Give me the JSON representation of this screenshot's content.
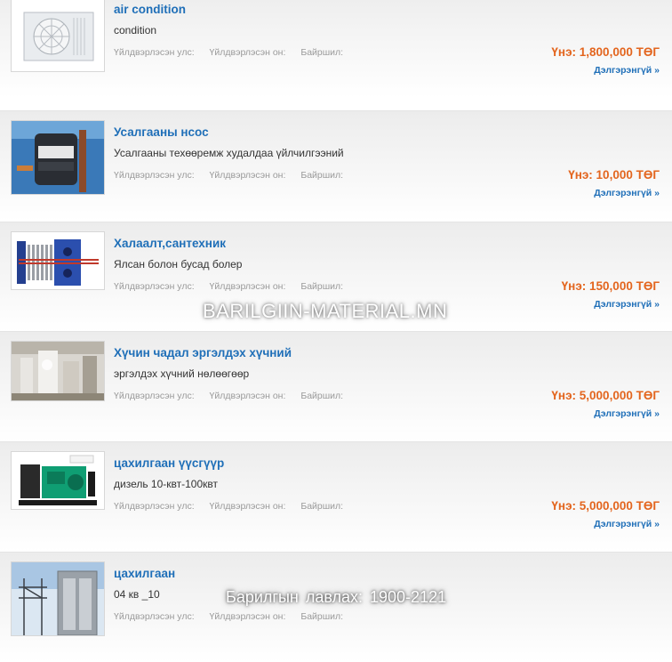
{
  "listings": [
    {
      "title": "air condition",
      "description": "condition",
      "meta_country": "Үйлдвэрлэсэн улс:",
      "meta_year": "Үйлдвэрлэсэн он:",
      "meta_location": "Байршил:",
      "price": "Үнэ: 1,800,000 ТӨГ",
      "more": "Дэлгэрэнгүй »",
      "image_icon": "air-conditioner-image"
    },
    {
      "title": "Усалгааны нсос",
      "description": "Усалгааны техөөремж худалдаа үйлчилгээний",
      "meta_country": "Үйлдвэрлэсэн улс:",
      "meta_year": "Үйлдвэрлэсэн он:",
      "meta_location": "Байршил:",
      "price": "Үнэ: 10,000 ТӨГ",
      "more": "Дэлгэрэнгүй »",
      "image_icon": "pump-image"
    },
    {
      "title": "Халаалт,сантехник",
      "description": "Ялсан болон бусад болер",
      "meta_country": "Үйлдвэрлэсэн улс:",
      "meta_year": "Үйлдвэрлэсэн он:",
      "meta_location": "Байршил:",
      "price": "Үнэ: 150,000 ТӨГ",
      "more": "Дэлгэрэнгүй »",
      "image_icon": "heat-exchanger-image"
    },
    {
      "title": "Хүчин чадал эргэлдэх хүчний",
      "description": "эргэлдэх хүчний нөлөөгөөр",
      "meta_country": "Үйлдвэрлэсэн улс:",
      "meta_year": "Үйлдвэрлэсэн он:",
      "meta_location": "Байршил:",
      "price": "Үнэ: 5,000,000 ТӨГ",
      "more": "Дэлгэрэнгүй »",
      "image_icon": "factory-image"
    },
    {
      "title": "цахилгаан үүсгүүр",
      "description": "дизель 10-квт-100квт",
      "meta_country": "Үйлдвэрлэсэн улс:",
      "meta_year": "Үйлдвэрлэсэн он:",
      "meta_location": "Байршил:",
      "price": "Үнэ: 5,000,000 ТӨГ",
      "more": "Дэлгэрэнгүй »",
      "image_icon": "generator-image"
    },
    {
      "title": "цахилгаан",
      "description": "04 кв _10",
      "meta_country": "Үйлдвэрлэсэн улс:",
      "meta_year": "Үйлдвэрлэсэн он:",
      "meta_location": "Байршил:",
      "price": "",
      "more": "",
      "image_icon": "substation-image"
    }
  ],
  "watermark": "BARILGIIN-MATERIAL.MN",
  "phone_overlay": "Барилгын  лавлах:  1900-2121",
  "colors": {
    "title": "#1f6fb8",
    "price": "#e3651e",
    "meta": "#9a9a9a"
  }
}
